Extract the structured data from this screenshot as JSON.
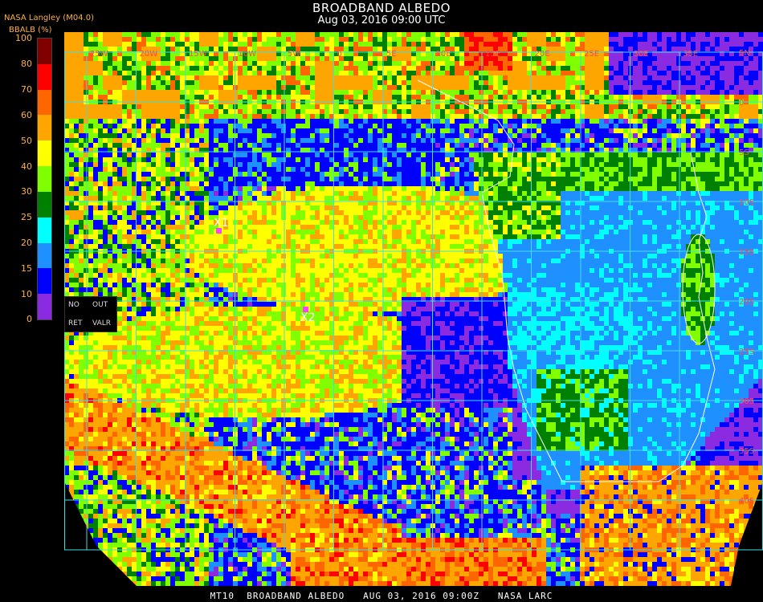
{
  "header": {
    "title": "BROADBAND ALBEDO",
    "subtitle": "Aug 03, 2016 09:00 UTC",
    "producer": "NASA Langley (M04.0)",
    "colorbar_label": "BBALB (%)"
  },
  "colorbar": {
    "ticks": [
      "100",
      "80",
      "70",
      "60",
      "50",
      "40",
      "30",
      "25",
      "20",
      "15",
      "10",
      "0"
    ],
    "segments": [
      {
        "from": 0,
        "to": 10,
        "color": "#8a2be2"
      },
      {
        "from": 10,
        "to": 15,
        "color": "#0000ff"
      },
      {
        "from": 15,
        "to": 20,
        "color": "#1e90ff"
      },
      {
        "from": 20,
        "to": 25,
        "color": "#00ffff"
      },
      {
        "from": 25,
        "to": 30,
        "color": "#008000"
      },
      {
        "from": 30,
        "to": 40,
        "color": "#7fff00"
      },
      {
        "from": 40,
        "to": 50,
        "color": "#ffff00"
      },
      {
        "from": 50,
        "to": 60,
        "color": "#ffa500"
      },
      {
        "from": 60,
        "to": 70,
        "color": "#ff6600"
      },
      {
        "from": 70,
        "to": 80,
        "color": "#ff0000"
      },
      {
        "from": 80,
        "to": 100,
        "color": "#800000"
      }
    ]
  },
  "legend": {
    "no": "NO",
    "out": "OUT",
    "ret": "RET",
    "valr": "VALR"
  },
  "markers": [
    {
      "label": "X1"
    },
    {
      "label": "X2"
    }
  ],
  "grid": {
    "line_color": "#40e0e0",
    "lon_labels": [
      "25W",
      "20W",
      "15W",
      "10W",
      "5W",
      "0",
      "5E",
      "10E",
      "15E",
      "20E",
      "25E",
      "30E",
      "35E"
    ],
    "lat_labels": [
      "5N",
      "0",
      "5S",
      "10S",
      "15S",
      "20S",
      "25S",
      "30S",
      "35S",
      "40S"
    ]
  },
  "footer": {
    "text": "MT10  BROADBAND ALBEDO   AUG 03, 2016 09:00Z   NASA LARC"
  }
}
